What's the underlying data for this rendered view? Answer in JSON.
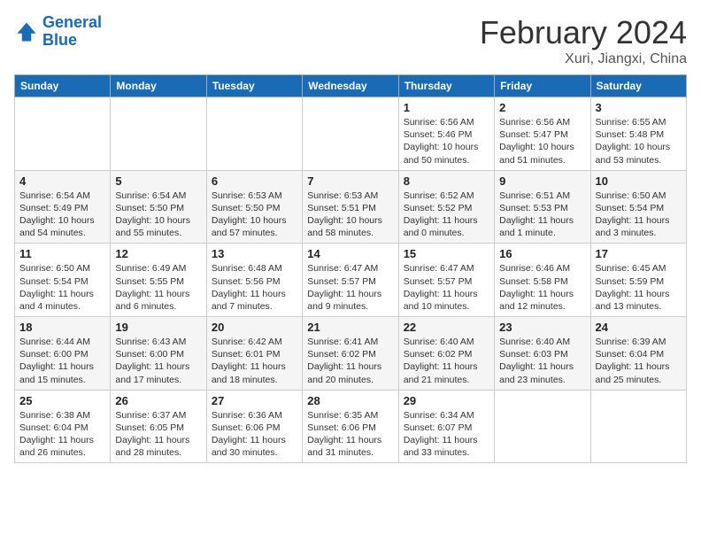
{
  "header": {
    "logo_line1": "General",
    "logo_line2": "Blue",
    "month": "February 2024",
    "location": "Xuri, Jiangxi, China"
  },
  "weekdays": [
    "Sunday",
    "Monday",
    "Tuesday",
    "Wednesday",
    "Thursday",
    "Friday",
    "Saturday"
  ],
  "weeks": [
    [
      {
        "day": "",
        "info": ""
      },
      {
        "day": "",
        "info": ""
      },
      {
        "day": "",
        "info": ""
      },
      {
        "day": "",
        "info": ""
      },
      {
        "day": "1",
        "info": "Sunrise: 6:56 AM\nSunset: 5:46 PM\nDaylight: 10 hours\nand 50 minutes."
      },
      {
        "day": "2",
        "info": "Sunrise: 6:56 AM\nSunset: 5:47 PM\nDaylight: 10 hours\nand 51 minutes."
      },
      {
        "day": "3",
        "info": "Sunrise: 6:55 AM\nSunset: 5:48 PM\nDaylight: 10 hours\nand 53 minutes."
      }
    ],
    [
      {
        "day": "4",
        "info": "Sunrise: 6:54 AM\nSunset: 5:49 PM\nDaylight: 10 hours\nand 54 minutes."
      },
      {
        "day": "5",
        "info": "Sunrise: 6:54 AM\nSunset: 5:50 PM\nDaylight: 10 hours\nand 55 minutes."
      },
      {
        "day": "6",
        "info": "Sunrise: 6:53 AM\nSunset: 5:50 PM\nDaylight: 10 hours\nand 57 minutes."
      },
      {
        "day": "7",
        "info": "Sunrise: 6:53 AM\nSunset: 5:51 PM\nDaylight: 10 hours\nand 58 minutes."
      },
      {
        "day": "8",
        "info": "Sunrise: 6:52 AM\nSunset: 5:52 PM\nDaylight: 11 hours\nand 0 minutes."
      },
      {
        "day": "9",
        "info": "Sunrise: 6:51 AM\nSunset: 5:53 PM\nDaylight: 11 hours\nand 1 minute."
      },
      {
        "day": "10",
        "info": "Sunrise: 6:50 AM\nSunset: 5:54 PM\nDaylight: 11 hours\nand 3 minutes."
      }
    ],
    [
      {
        "day": "11",
        "info": "Sunrise: 6:50 AM\nSunset: 5:54 PM\nDaylight: 11 hours\nand 4 minutes."
      },
      {
        "day": "12",
        "info": "Sunrise: 6:49 AM\nSunset: 5:55 PM\nDaylight: 11 hours\nand 6 minutes."
      },
      {
        "day": "13",
        "info": "Sunrise: 6:48 AM\nSunset: 5:56 PM\nDaylight: 11 hours\nand 7 minutes."
      },
      {
        "day": "14",
        "info": "Sunrise: 6:47 AM\nSunset: 5:57 PM\nDaylight: 11 hours\nand 9 minutes."
      },
      {
        "day": "15",
        "info": "Sunrise: 6:47 AM\nSunset: 5:57 PM\nDaylight: 11 hours\nand 10 minutes."
      },
      {
        "day": "16",
        "info": "Sunrise: 6:46 AM\nSunset: 5:58 PM\nDaylight: 11 hours\nand 12 minutes."
      },
      {
        "day": "17",
        "info": "Sunrise: 6:45 AM\nSunset: 5:59 PM\nDaylight: 11 hours\nand 13 minutes."
      }
    ],
    [
      {
        "day": "18",
        "info": "Sunrise: 6:44 AM\nSunset: 6:00 PM\nDaylight: 11 hours\nand 15 minutes."
      },
      {
        "day": "19",
        "info": "Sunrise: 6:43 AM\nSunset: 6:00 PM\nDaylight: 11 hours\nand 17 minutes."
      },
      {
        "day": "20",
        "info": "Sunrise: 6:42 AM\nSunset: 6:01 PM\nDaylight: 11 hours\nand 18 minutes."
      },
      {
        "day": "21",
        "info": "Sunrise: 6:41 AM\nSunset: 6:02 PM\nDaylight: 11 hours\nand 20 minutes."
      },
      {
        "day": "22",
        "info": "Sunrise: 6:40 AM\nSunset: 6:02 PM\nDaylight: 11 hours\nand 21 minutes."
      },
      {
        "day": "23",
        "info": "Sunrise: 6:40 AM\nSunset: 6:03 PM\nDaylight: 11 hours\nand 23 minutes."
      },
      {
        "day": "24",
        "info": "Sunrise: 6:39 AM\nSunset: 6:04 PM\nDaylight: 11 hours\nand 25 minutes."
      }
    ],
    [
      {
        "day": "25",
        "info": "Sunrise: 6:38 AM\nSunset: 6:04 PM\nDaylight: 11 hours\nand 26 minutes."
      },
      {
        "day": "26",
        "info": "Sunrise: 6:37 AM\nSunset: 6:05 PM\nDaylight: 11 hours\nand 28 minutes."
      },
      {
        "day": "27",
        "info": "Sunrise: 6:36 AM\nSunset: 6:06 PM\nDaylight: 11 hours\nand 30 minutes."
      },
      {
        "day": "28",
        "info": "Sunrise: 6:35 AM\nSunset: 6:06 PM\nDaylight: 11 hours\nand 31 minutes."
      },
      {
        "day": "29",
        "info": "Sunrise: 6:34 AM\nSunset: 6:07 PM\nDaylight: 11 hours\nand 33 minutes."
      },
      {
        "day": "",
        "info": ""
      },
      {
        "day": "",
        "info": ""
      }
    ]
  ]
}
